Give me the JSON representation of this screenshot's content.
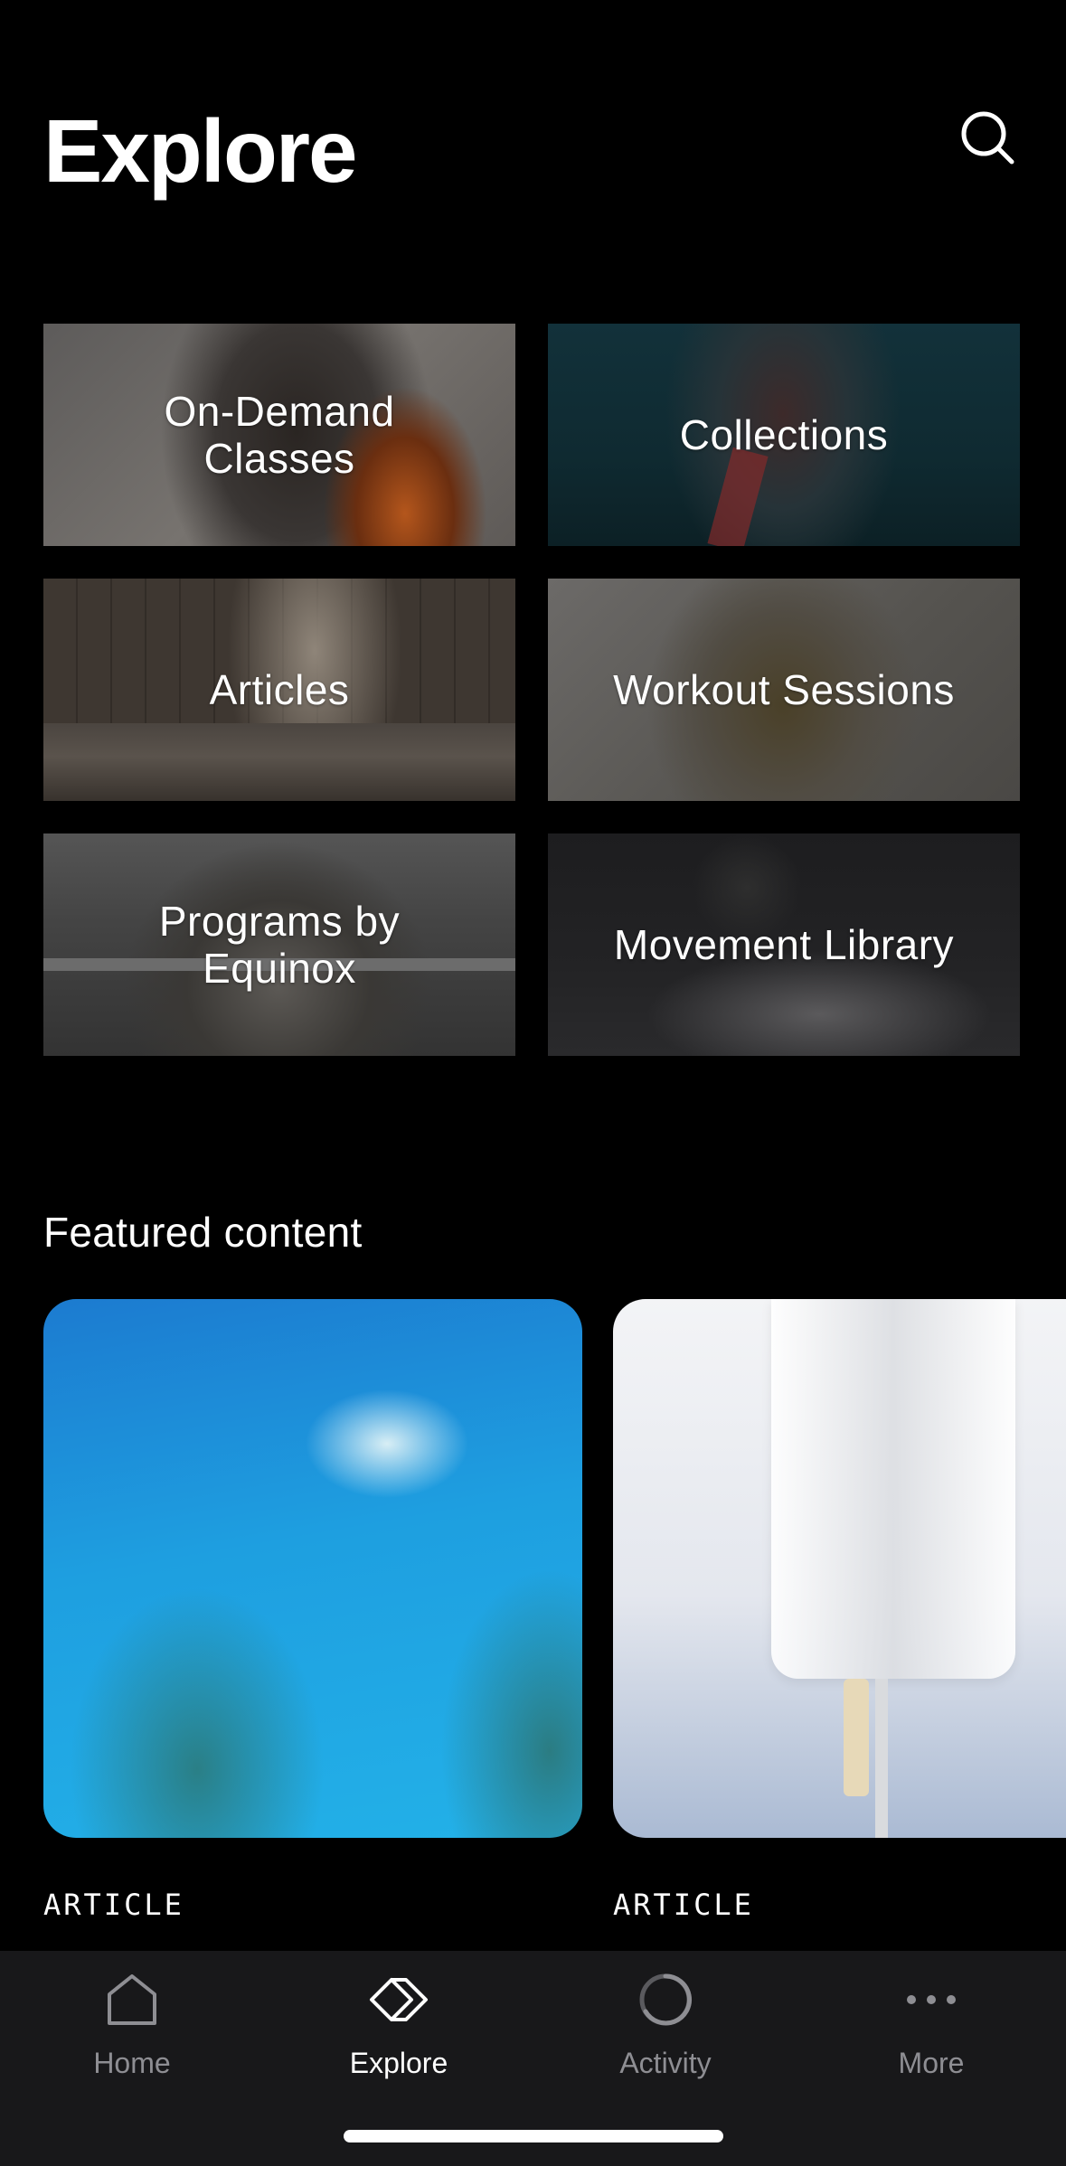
{
  "header": {
    "title": "Explore"
  },
  "tiles": [
    {
      "label": "On-Demand\nClasses"
    },
    {
      "label": "Collections"
    },
    {
      "label": "Articles"
    },
    {
      "label": "Workout Sessions"
    },
    {
      "label": "Programs by\nEquinox"
    },
    {
      "label": "Movement Library"
    }
  ],
  "featured": {
    "title": "Featured content",
    "cards": [
      {
        "kind": "ARTICLE"
      },
      {
        "kind": "ARTICLE"
      }
    ]
  },
  "tabbar": {
    "tabs": [
      {
        "label": "Home",
        "icon": "home-icon"
      },
      {
        "label": "Explore",
        "icon": "explore-icon",
        "active": true
      },
      {
        "label": "Activity",
        "icon": "activity-icon"
      },
      {
        "label": "More",
        "icon": "more-icon"
      }
    ]
  }
}
